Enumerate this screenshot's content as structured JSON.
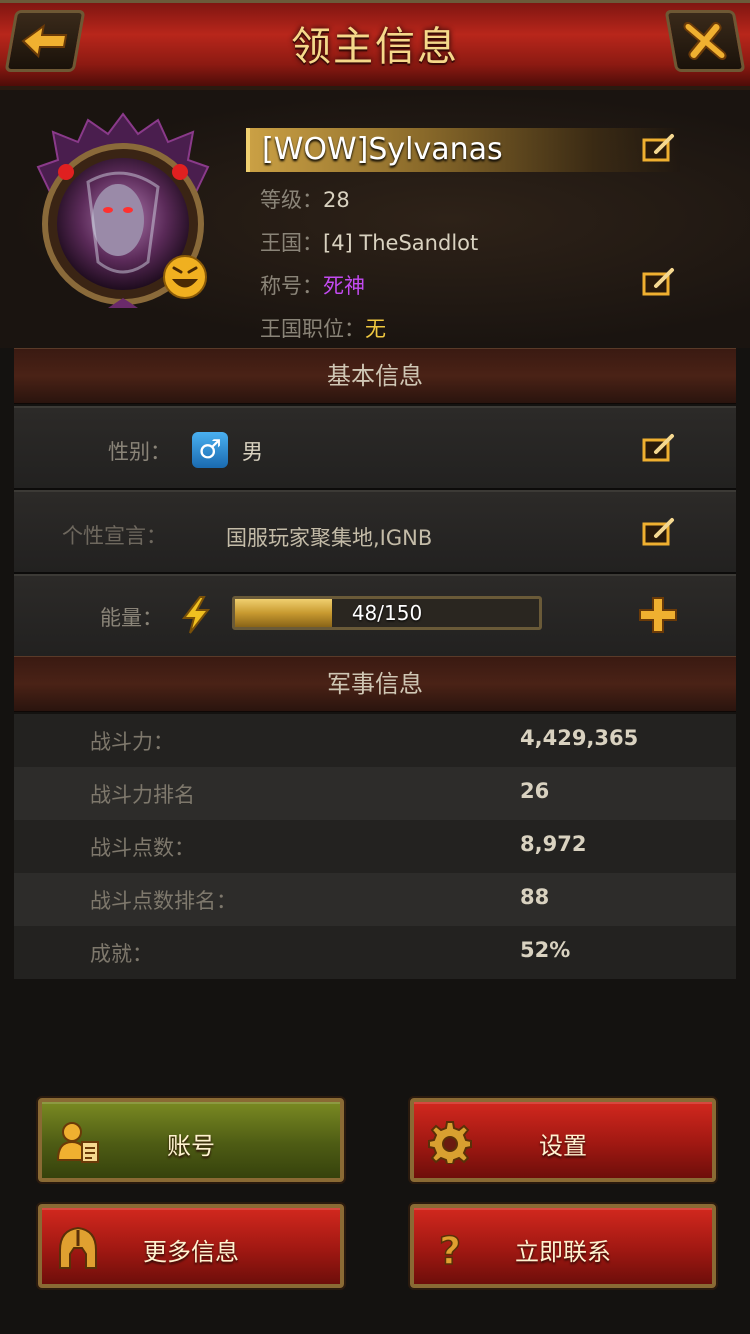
{
  "header": {
    "title": "领主信息"
  },
  "profile": {
    "name": "[WOW]Sylvanas",
    "level_label": "等级：",
    "level_value": "28",
    "kingdom_label": "王国：",
    "kingdom_value": "[4] TheSandlot",
    "title_label": "称号：",
    "title_value": "死神",
    "position_label": "王国职位：",
    "position_value": "无"
  },
  "basic": {
    "section_title": "基本信息",
    "gender_label": "性别：",
    "gender_value": "男",
    "motto_label": "个性宣言：",
    "motto_value": "国服玩家聚集地,IGNB",
    "energy_label": "能量：",
    "energy_text": "48/150",
    "energy_current": 48,
    "energy_max": 150
  },
  "military": {
    "section_title": "军事信息",
    "rows": [
      {
        "label": "战斗力：",
        "value": "4,429,365"
      },
      {
        "label": "战斗力排名",
        "value": "26"
      },
      {
        "label": "战斗点数：",
        "value": "8,972"
      },
      {
        "label": "战斗点数排名：",
        "value": "88"
      },
      {
        "label": "成就：",
        "value": "52%"
      }
    ]
  },
  "buttons": {
    "account": "账号",
    "settings": "设置",
    "more_info": "更多信息",
    "contact": "立即联系"
  },
  "colors": {
    "title_purple": "#c24af0",
    "position_yellow": "#f0c840",
    "header_red": "#b8261b",
    "gold": "#f0d070"
  }
}
